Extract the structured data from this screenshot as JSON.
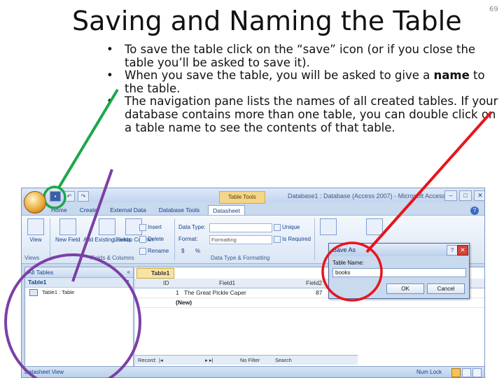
{
  "slide": {
    "title": "Saving and Naming the Table",
    "page_number": "69",
    "bullets": [
      {
        "text": "To save the table click on the “save” icon (or if you close the table you’ll be asked to save it)."
      },
      {
        "pre": "When you save the table, you will be asked to give a ",
        "bold": "name",
        "post": " to the table."
      },
      {
        "text": "The navigation pane lists the names of all created tables.  If your database contains more than one table, you can double click on a table name to see the contents of that table."
      }
    ]
  },
  "access": {
    "window_title": "Database1 : Database (Access 2007) - Microsoft Access",
    "context_tab": "Table Tools",
    "tabs": [
      "Home",
      "Create",
      "External Data",
      "Database Tools",
      "Datasheet"
    ],
    "active_tab": "Datasheet",
    "ribbon": {
      "view": "View",
      "new_field": "New\nField",
      "add_existing": "Add Existing\nFields",
      "lookup_column": "Lookup\nColumn",
      "insert": "Insert",
      "delete": "Delete",
      "rename": "Rename",
      "data_type_label": "Data Type:",
      "format_label": "Format:",
      "format_value": "Formatting",
      "currency": "$",
      "percent": "%",
      "unique": "Unique",
      "is_required": "Is Required",
      "group_views": "Views",
      "group_fields_columns": "Fields & Columns",
      "group_datatype": "Data Type & Formatting"
    },
    "nav_pane": {
      "header": "All Tables",
      "group": "Table1",
      "item": "Table1 : Table"
    },
    "document_tab": "Table1",
    "grid": {
      "headers": [
        "ID",
        "Field1",
        "Field2"
      ],
      "row1": {
        "id": "1",
        "field1": "The Great Pickle Caper",
        "field2": "87"
      },
      "new_row": "(New)"
    },
    "record_nav": {
      "label": "Record:",
      "filter": "No Filter",
      "search": "Search"
    },
    "status": {
      "left": "Datasheet View",
      "num_lock": "Num Lock"
    },
    "dialog": {
      "title": "Save As",
      "help": "?",
      "close": "✕",
      "label": "Table Name:",
      "value": "books",
      "ok": "OK",
      "cancel": "Cancel"
    }
  },
  "colors": {
    "arrow_green": "#1aa84a",
    "arrow_red": "#e8141b",
    "circle_purple": "#7b3fa6"
  },
  "icons": [
    "save-icon",
    "undo-icon",
    "redo-icon",
    "office-button-icon",
    "table-icon",
    "help-icon",
    "close-icon"
  ]
}
